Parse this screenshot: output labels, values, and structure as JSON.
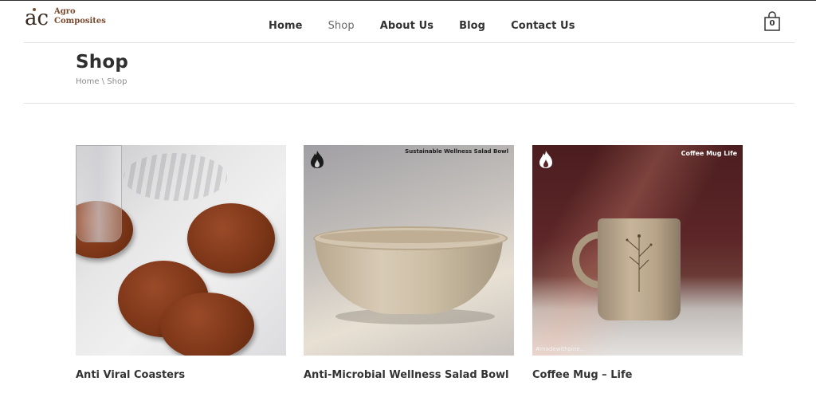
{
  "brand": {
    "logo_mark": "ac",
    "name_line1": "Agro",
    "name_line2": "Composites"
  },
  "nav": {
    "items": [
      {
        "label": "Home",
        "active": false
      },
      {
        "label": "Shop",
        "active": true
      },
      {
        "label": "About Us",
        "active": false
      },
      {
        "label": "Blog",
        "active": false
      },
      {
        "label": "Contact Us",
        "active": false
      }
    ]
  },
  "cart": {
    "icon": "shopping-bag-icon",
    "count": "0"
  },
  "page": {
    "title": "Shop",
    "breadcrumb": {
      "home": "Home",
      "separator": "\\",
      "current": "Shop"
    }
  },
  "products": [
    {
      "name": "Anti Viral Coasters",
      "image_caption": ""
    },
    {
      "name": "Anti-Microbial Wellness Salad Bowl",
      "image_caption": "Sustainable Wellness Salad Bowl"
    },
    {
      "name": "Coffee Mug – Life",
      "image_caption": "Coffee Mug  Life",
      "image_hashtag": "#madewithpine..."
    }
  ],
  "colors": {
    "brand": "#7a4a2e",
    "text": "#333333",
    "muted": "#8a8a8a",
    "divider": "#e2e2e2"
  }
}
